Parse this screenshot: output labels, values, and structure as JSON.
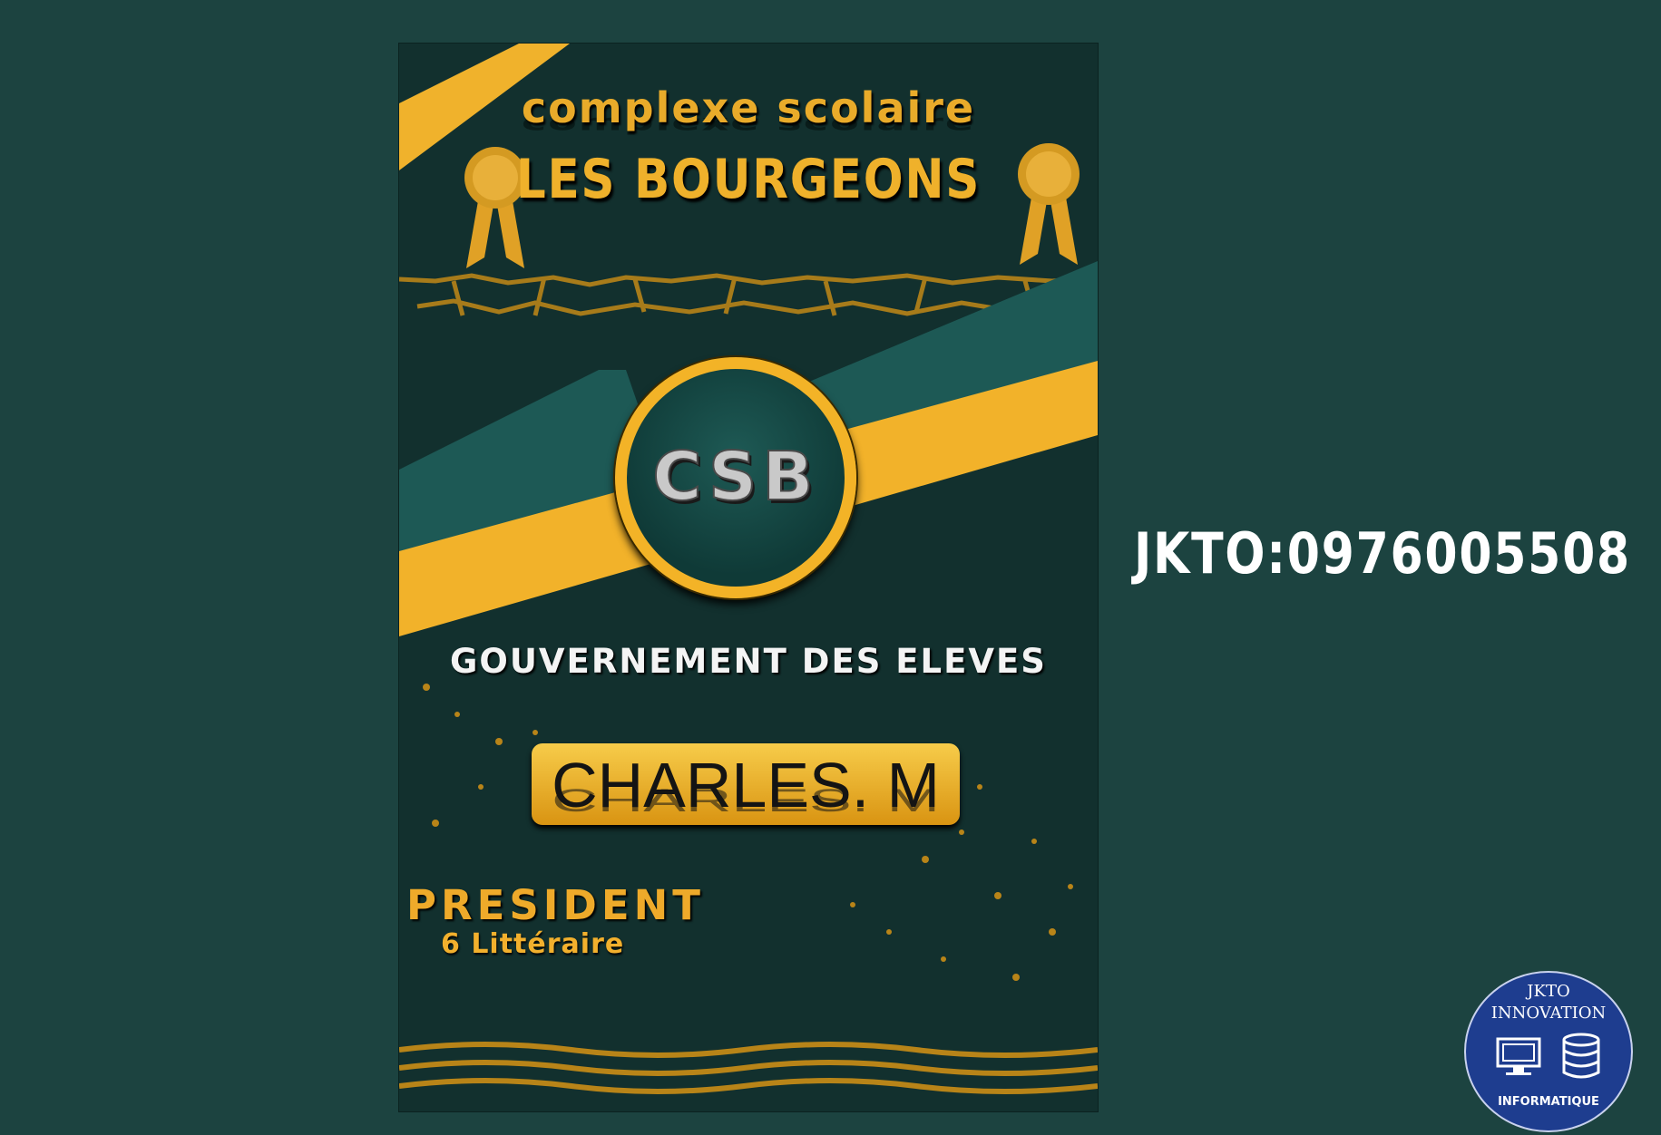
{
  "card": {
    "school_sub": "complexe scolaire",
    "school_name": "LES BOURGEONS",
    "logo_text": "CSB",
    "gov_label": "GOUVERNEMENT DES ELEVES",
    "person_name": "CHARLES. M",
    "role": "PRESIDENT",
    "class_label": "6 Littéraire",
    "icons": [
      "award-ribbon-icon",
      "award-ribbon-icon"
    ]
  },
  "contact": {
    "text": "JKTO:0976005508"
  },
  "brand": {
    "line1": "JKTO",
    "line2": "INNOVATION",
    "line3": "INFORMATIQUE",
    "icons": [
      "monitor-icon",
      "database-icon"
    ]
  },
  "colors": {
    "background": "#1c4340",
    "card": "#12302e",
    "gold": "#efb12b",
    "teal": "#1e5a55",
    "brand_blue": "#1e3d8f"
  }
}
